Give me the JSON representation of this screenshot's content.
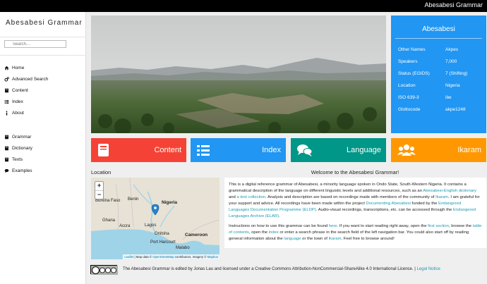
{
  "topbar": {
    "brand": "Abesabesi Grammar"
  },
  "sidebar": {
    "title": "Abesabesi Grammar",
    "search_placeholder": "Search...",
    "nav_primary": [
      {
        "label": "Home",
        "icon": "home-icon"
      },
      {
        "label": "Advanced Search",
        "icon": "gears-icon"
      },
      {
        "label": "Content",
        "icon": "book-icon"
      },
      {
        "label": "Index",
        "icon": "list-icon"
      },
      {
        "label": "About",
        "icon": "info-icon"
      }
    ],
    "nav_secondary": [
      {
        "label": "Grammar",
        "icon": "book-icon"
      },
      {
        "label": "Dictionary",
        "icon": "book-icon"
      },
      {
        "label": "Texts",
        "icon": "book-icon"
      },
      {
        "label": "Examples",
        "icon": "comment-icon"
      }
    ]
  },
  "info": {
    "title": "Abesabesi",
    "rows": [
      {
        "key": "Other Names",
        "value": "Akpes"
      },
      {
        "key": "Speakers",
        "value": "7,000"
      },
      {
        "key": "Status (EGIDS)",
        "value": "7 (Shifting)"
      },
      {
        "key": "Location",
        "value": "Nigeria"
      },
      {
        "key": "ISO 639-3",
        "value": "ibe"
      },
      {
        "key": "Glottocode",
        "value": "akpe1248"
      }
    ]
  },
  "tiles": [
    {
      "label": "Content",
      "color": "#f44336",
      "icon": "book-icon"
    },
    {
      "label": "Index",
      "color": "#2196f3",
      "icon": "list-icon"
    },
    {
      "label": "Language",
      "color": "#009688",
      "icon": "comments-icon"
    },
    {
      "label": "Ikaram",
      "color": "#ff9800",
      "icon": "users-icon"
    }
  ],
  "location": {
    "title": "Location",
    "labels": [
      "Burkina Faso",
      "Benin",
      "Nigeria",
      "Ghana",
      "Accra",
      "Lagos",
      "Onitsha",
      "Port Harcourt",
      "Cameroon",
      "Malabo"
    ],
    "attribution": {
      "leaflet": "Leaflet",
      "mid": " | Map data © ",
      "osm": "OpenStreetMap",
      "tail": " contributors, Imagery © ",
      "mapbox": "Mapbox"
    }
  },
  "welcome": {
    "title": "Welcome to the Abesabesi Grammar!",
    "p1": {
      "t1": "This is a digital reference grammar of Abesabesi, a minority language spoken in Ondo State, South-Western Nigeria. It contains a grammatical description of the language on different linguistic levels and additional resources, such as an ",
      "l1": "Abesabesi-English dictionary",
      "t2": " and ",
      "l2": "a text collection",
      "t3": ". Analysis and description are based on recordings made with members of the community of ",
      "l3": "Ikaram",
      "t4": ". I am grateful for your support and advice. All recordings have been made within the project ",
      "l4": "Documenting Abesabesi",
      "t5": " funded by the ",
      "l5": "Endangered Languages Documentation Programme (ELDP)",
      "t6": ". Audio-visual recordings, transcriptions, etc. can be accessed through the ",
      "l6": "Endangered Languages Archive (ELAR)",
      "t7": "."
    },
    "p2": {
      "t1": "Instructions on how to use this grammar can be found ",
      "l1": "here",
      "t2": ". If you want to start reading right away, open the ",
      "l2": "first section",
      "t3": ", browse the ",
      "l3": "table of contents",
      "t4": ", open the ",
      "l4": "index",
      "t5": " or enter a search phrase in the search field of the left navigation bar. You could also start off by reading general information about the ",
      "l5": "language",
      "t6": " or the town of ",
      "l6": "Ikaram",
      "t7": ". Feel free to browse around!"
    }
  },
  "footer": {
    "text": "The Abesabesi Grammar is edited by Jonas Lau and licensed under a Creative Commons Attribution-NonCommercial-ShareAlike 4.0 International Licence. | ",
    "link": "Legal Notice"
  }
}
